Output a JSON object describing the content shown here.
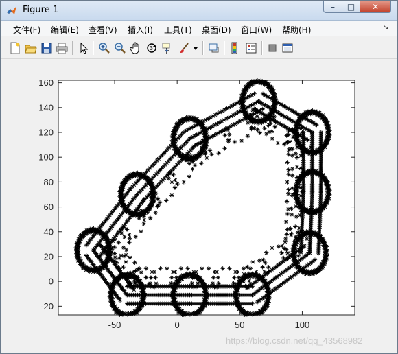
{
  "window": {
    "title": "Figure 1",
    "controls": {
      "minimize": "–",
      "maximize": "□",
      "close": "✕"
    }
  },
  "menubar": {
    "items": [
      {
        "label": "文件(F)"
      },
      {
        "label": "编辑(E)"
      },
      {
        "label": "查看(V)"
      },
      {
        "label": "插入(I)"
      },
      {
        "label": "工具(T)"
      },
      {
        "label": "桌面(D)"
      },
      {
        "label": "窗口(W)"
      },
      {
        "label": "帮助(H)"
      }
    ],
    "overflow_icon": "undock-arrow-icon"
  },
  "toolbar": {
    "buttons": [
      "new-figure-icon",
      "open-file-icon",
      "save-icon",
      "print-icon",
      "select-arrow-icon",
      "zoom-in-icon",
      "zoom-out-icon",
      "pan-hand-icon",
      "rotate-3d-icon",
      "data-cursor-icon",
      "brush-icon",
      "link-plot-icon",
      "colorbar-icon",
      "legend-icon",
      "hide-plot-tools-icon",
      "show-plot-tools-icon"
    ]
  },
  "chart_data": {
    "type": "scatter",
    "marker": "*",
    "color": "#000000",
    "title": "",
    "xlabel": "",
    "ylabel": "",
    "xlim": [
      -95,
      142
    ],
    "ylim": [
      -27,
      162
    ],
    "xticks": [
      -50,
      0,
      50,
      100
    ],
    "yticks": [
      -20,
      0,
      20,
      40,
      60,
      80,
      100,
      120,
      140,
      160
    ],
    "grid": false,
    "legend": "none",
    "rings": [
      {
        "cx": 65,
        "cy": 145,
        "r": 13
      },
      {
        "cx": 108,
        "cy": 120,
        "r": 13
      },
      {
        "cx": 108,
        "cy": 72,
        "r": 13
      },
      {
        "cx": 106,
        "cy": 23,
        "r": 13
      },
      {
        "cx": 60,
        "cy": -11,
        "r": 13
      },
      {
        "cx": 10,
        "cy": -11,
        "r": 13
      },
      {
        "cx": -40,
        "cy": -11,
        "r": 13
      },
      {
        "cx": -67,
        "cy": 25,
        "r": 13
      },
      {
        "cx": -32,
        "cy": 70,
        "r": 13
      },
      {
        "cx": 10,
        "cy": 115,
        "r": 13
      }
    ],
    "inner_loop_radius": 6
  },
  "watermark": "https://blog.csdn.net/qq_43568982"
}
